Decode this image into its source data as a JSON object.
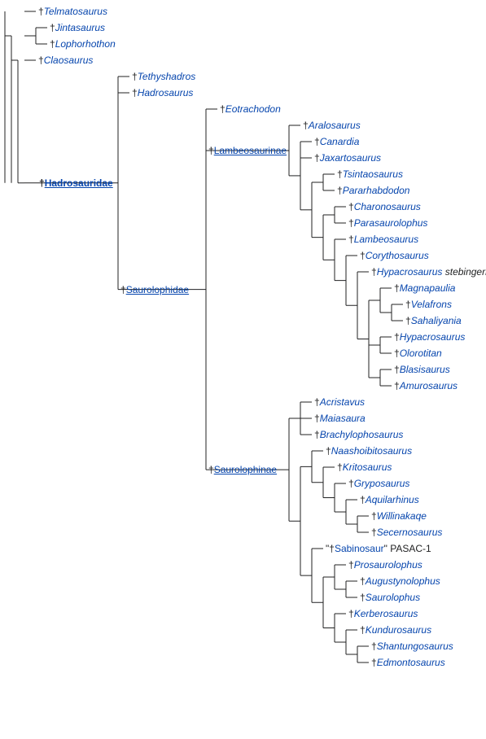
{
  "colors": {
    "link": "#0645AD",
    "text": "#202122",
    "line": "#202122"
  },
  "taxa": {
    "telmatosaurus": "Telmatosaurus",
    "jintasaurus": "Jintasaurus",
    "lophorhothon": "Lophorhothon",
    "claosaurus": "Claosaurus",
    "tethyshadros": "Tethyshadros",
    "hadrosaurus": "Hadrosaurus",
    "eotrachodon": "Eotrachodon",
    "hadrosauridae": "Hadrosauridae",
    "saurolophidae": "Saurolophidae",
    "lambeosaurinae": "Lambeosaurinae",
    "saurolophinae": "Saurolophinae",
    "aralosaurus": "Aralosaurus",
    "canardia": "Canardia",
    "jaxartosaurus": "Jaxartosaurus",
    "tsintaosaurus": "Tsintaosaurus",
    "pararhabdodon": "Pararhabdodon",
    "charonosaurus": "Charonosaurus",
    "parasaurolophus": "Parasaurolophus",
    "lambeosaurus": "Lambeosaurus",
    "corythosaurus": "Corythosaurus",
    "hypacrosaurus_stebingeri_g": "Hypacrosaurus",
    "hypacrosaurus_stebingeri_s": "stebingeri",
    "magnapaulia": "Magnapaulia",
    "velafrons": "Velafrons",
    "sahaliyania": "Sahaliyania",
    "hypacrosaurus": "Hypacrosaurus",
    "olorotitan": "Olorotitan",
    "blasisaurus": "Blasisaurus",
    "amurosaurus": "Amurosaurus",
    "acristavus": "Acristavus",
    "maiasaura": "Maiasaura",
    "brachylophosaurus": "Brachylophosaurus",
    "naashoibitosaurus": "Naashoibitosaurus",
    "kritosaurus": "Kritosaurus",
    "gryposaurus": "Gryposaurus",
    "aquilarhinus": "Aquilarhinus",
    "willinakaqe": "Willinakaqe",
    "secernosaurus": "Secernosaurus",
    "sabinosaur_pre": "\"†",
    "sabinosaur": "Sabinosaur",
    "sabinosaur_suf": "\" PASAC-1",
    "prosaurolophus": "Prosaurolophus",
    "augustynolophus": "Augustynolophus",
    "saurolophus": "Saurolophus",
    "kerberosaurus": "Kerberosaurus",
    "kundurosaurus": "Kundurosaurus",
    "shantungosaurus": "Shantungosaurus",
    "edmontosaurus": "Edmontosaurus"
  }
}
